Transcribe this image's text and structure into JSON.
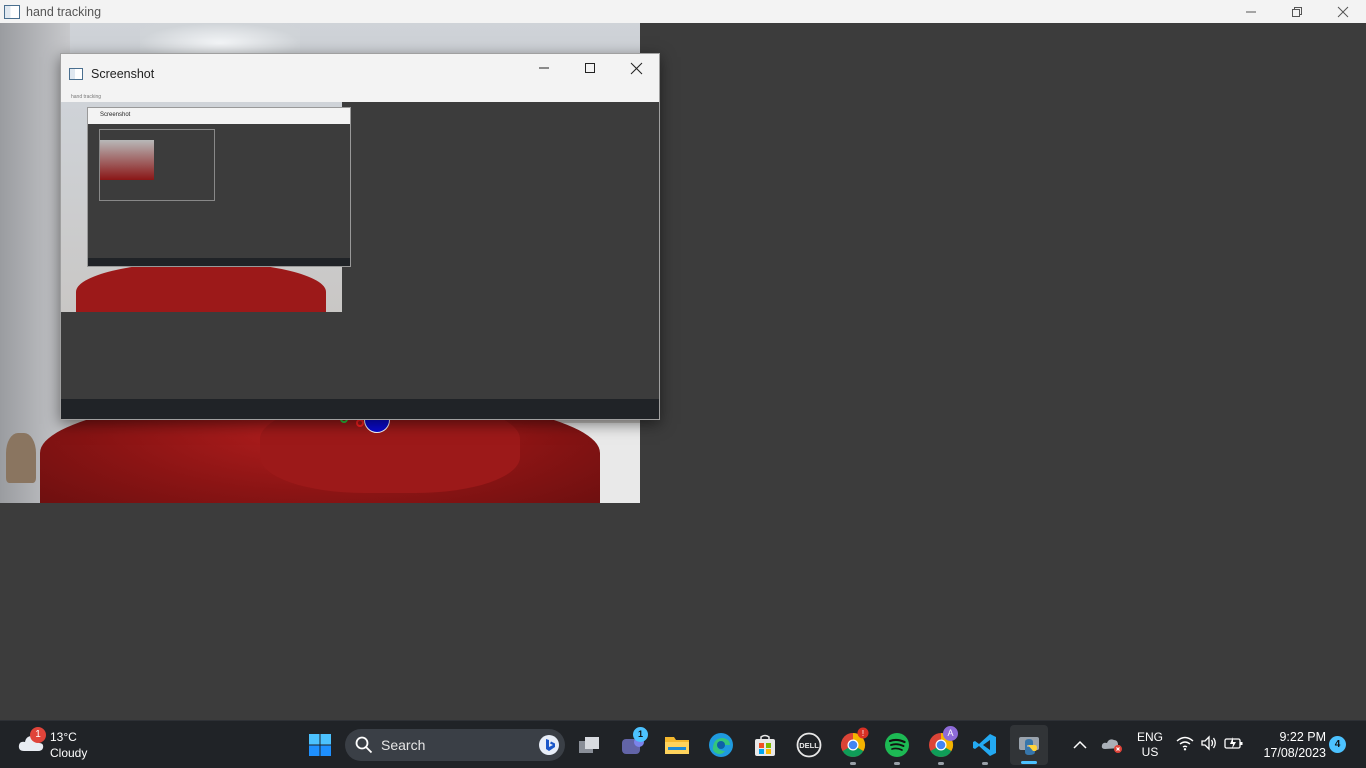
{
  "outer_window": {
    "title": "hand tracking"
  },
  "screenshot_window": {
    "title": "Screenshot",
    "nested_title": "hand tracking",
    "nested_screenshot_title": "Screenshot"
  },
  "taskbar": {
    "weather": {
      "temp": "13°C",
      "condition": "Cloudy",
      "badge": "1"
    },
    "search_label": "Search",
    "teams_badge": "1",
    "chrome_profile_letter": "A",
    "language_top": "ENG",
    "language_bottom": "US",
    "time": "9:22 PM",
    "date": "17/08/2023",
    "notification_count": "4"
  },
  "colors": {
    "taskbar_bg": "#202327",
    "desktop_bg": "#3c3c3c",
    "accent": "#4cc2ff"
  }
}
